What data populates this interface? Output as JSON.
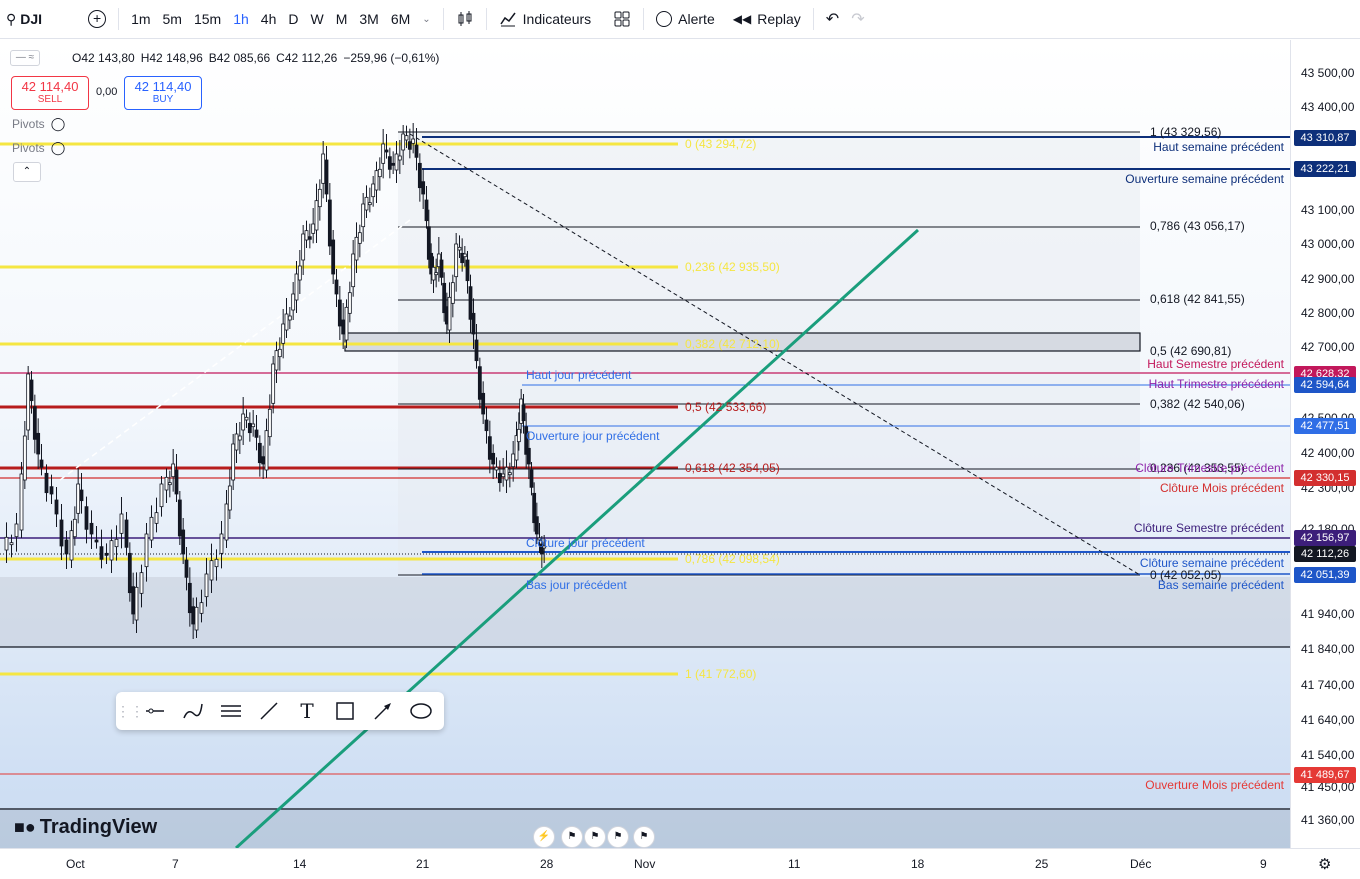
{
  "toolbar": {
    "symbol": "DJI",
    "timeframes": [
      "1m",
      "5m",
      "15m",
      "1h",
      "4h",
      "D",
      "W",
      "M",
      "3M",
      "6M"
    ],
    "active_timeframe": "1h",
    "indicators_label": "Indicateurs",
    "alert_label": "Alerte",
    "replay_label": "Replay"
  },
  "legend": {
    "open": "O42 143,80",
    "high": "H42 148,96",
    "low": "B42 085,66",
    "close": "C42 112,26",
    "change": "−259,96 (−0,61%)",
    "sell_price": "42 114,40",
    "sell_label": "SELL",
    "spread": "0,00",
    "buy_price": "42 114,40",
    "buy_label": "BUY",
    "pivots1": "Pivots",
    "pivots2": "Pivots"
  },
  "price_axis": {
    "labels": [
      "43 500,00",
      "43 400,00",
      "43 100,00",
      "43 000,00",
      "42 900,00",
      "42 800,00",
      "42 700,00",
      "42 500,00",
      "42 400,00",
      "42 300,00",
      "42 180,00",
      "41 940,00",
      "41 840,00",
      "41 740,00",
      "41 640,00",
      "41 540,00",
      "41 450,00",
      "41 360,00"
    ],
    "badges": [
      {
        "text": "43 310,87",
        "color": "#0d2f7a"
      },
      {
        "text": "43 222,21",
        "color": "#0d2f7a"
      },
      {
        "text": "42 628,32",
        "color": "#c2185b"
      },
      {
        "text": "42 594,64",
        "color": "#1e56c8"
      },
      {
        "text": "42 477,51",
        "color": "#2f6ee6"
      },
      {
        "text": "42 330,15",
        "color": "#d32f2f"
      },
      {
        "text": "42 156,97",
        "color": "#3c1e7a"
      },
      {
        "text": "42 112,26",
        "color": "#131722"
      },
      {
        "text": "42 051,39",
        "color": "#1e56c8"
      },
      {
        "text": "41 489,67",
        "color": "#e53935"
      }
    ]
  },
  "time_axis": [
    "Oct",
    "7",
    "14",
    "21",
    "28",
    "Nov",
    "11",
    "18",
    "25",
    "Déc",
    "9"
  ],
  "fib_black": [
    "1 (43 329,56)",
    "0,786 (43 056,17)",
    "0,618 (42 841,55)",
    "0,5 (42 690,81)",
    "0,382 (42 540,06)",
    "0,236 (42 353,55)",
    "0 (42 052,05)"
  ],
  "fib_yellow": [
    "0 (43 294,72)",
    "0,236 (42 935,50)",
    "0,382 (42 712,10)",
    "0,5 (42 533,66)",
    "0,618 (42 354,05)",
    "0,786 (42 098,54)",
    "1 (41 772,60)"
  ],
  "levels": {
    "haut_semaine": "Haut semaine  précédent",
    "ouverture_semaine": "Ouverture semaine  précédent",
    "haut_semestre": "Haut Semestre précédent",
    "haut_trimestre": "Haut Trimestre précédent",
    "haut_jour": "Haut jour précédent",
    "ouverture_jour": "Ouverture jour précédent",
    "cloture_trimestre": "Clôture Trimestre précédent",
    "cloture_mois": "Clôture Mois précédent",
    "cloture_semestre": "Clôture Semestre précédent",
    "cloture_jour": "Clôture jour précédent",
    "cloture_semaine": "Clôture semaine précédent",
    "bas_jour": "Bas jour précédent",
    "bas_semaine": "Bas semaine précédent",
    "ouverture_mois": "Ouverture Mois précédent"
  },
  "logo_text": "TradingView",
  "colors": {
    "accent": "#2962ff",
    "fib_yellow": "#f5e642",
    "trend": "#1a9e7c"
  }
}
